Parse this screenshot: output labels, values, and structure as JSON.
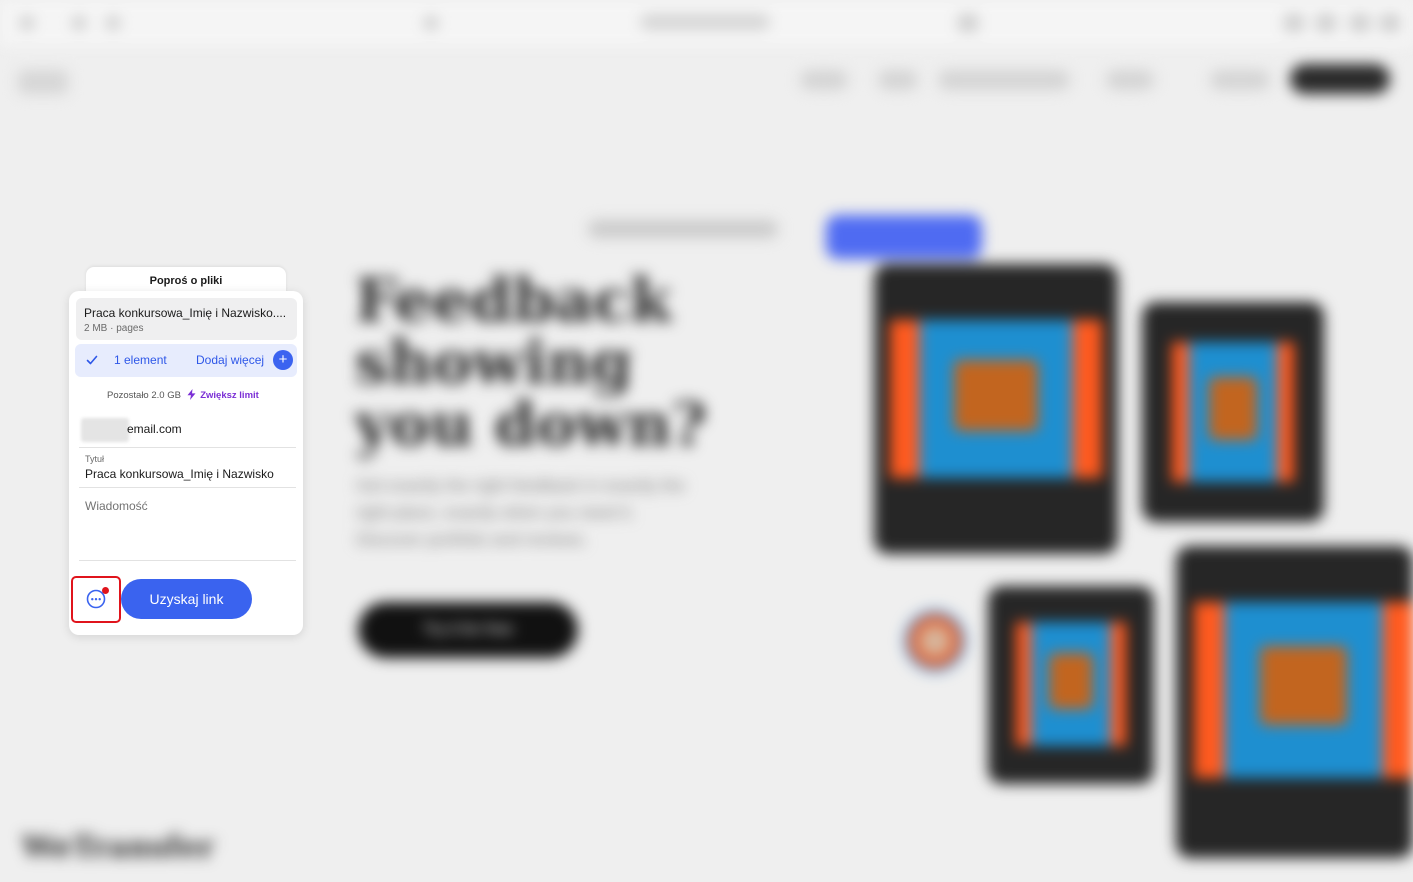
{
  "background": {
    "hero_title": "Feedback showing you down?",
    "hero_subtitle": "Get exactly the right feedback in exactly the right place, exactly when you need it. Discover portfolio and reviews.",
    "hero_cta": "Try it for free",
    "footer_word": "WeTransfer"
  },
  "panel": {
    "tab_label": "Poproś o pliki",
    "file": {
      "name": "Praca konkursowa_Imię i Nazwisko....",
      "meta": "2 MB · pages"
    },
    "selected_count": "1 element",
    "add_more_label": "Dodaj więcej",
    "add_icon": "plus-icon",
    "storage_remaining": "Pozostało 2.0 GB",
    "upgrade_label": "Zwiększ limit",
    "email_value": "email.com",
    "title_label": "Tytuł",
    "title_value": "Praca konkursowa_Imię i Nazwisko",
    "message_placeholder": "Wiadomość",
    "get_link_label": "Uzyskaj link"
  },
  "colors": {
    "accent_blue": "#3a63ef",
    "upgrade_purple": "#7b2fd6",
    "highlight_red": "#e0141c",
    "selected_bg": "#e7ecfd"
  }
}
